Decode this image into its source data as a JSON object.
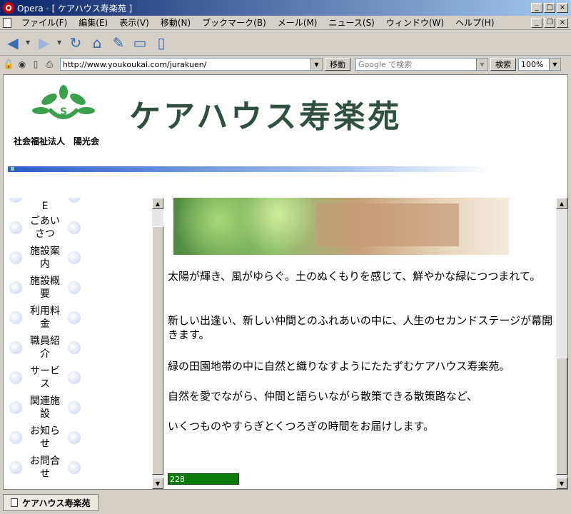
{
  "window": {
    "app_icon": "O",
    "title": "Opera - [ ケアハウス寿楽苑 ]"
  },
  "menu": {
    "items": [
      "ファイル(F)",
      "編集(E)",
      "表示(V)",
      "移動(N)",
      "ブックマーク(B)",
      "メール(M)",
      "ニュース(S)",
      "ウィンドウ(W)",
      "ヘルプ(H)"
    ]
  },
  "toolbar": {
    "icons": [
      "back-icon",
      "forward-icon",
      "reload-icon",
      "home-icon",
      "hotlist-icon",
      "print-icon",
      "new-page-icon"
    ]
  },
  "address": {
    "url": "http://www.youkoukai.com/jurakuen/",
    "go_label": "移動",
    "search_placeholder": "Google で検索",
    "search_label": "検索",
    "zoom": "100%"
  },
  "header": {
    "org_name": "社会福祉法人　陽光会",
    "site_title": "ケアハウス寿楽苑"
  },
  "nav": {
    "items": [
      {
        "label": "E"
      },
      {
        "label": "ごあいさつ"
      },
      {
        "label": "施設案内"
      },
      {
        "label": "施設概要"
      },
      {
        "label": "利用料金"
      },
      {
        "label": "職員紹介"
      },
      {
        "label": "サービス"
      },
      {
        "label": "関連施設"
      },
      {
        "label": "お知らせ"
      },
      {
        "label": "お問合せ"
      }
    ]
  },
  "main": {
    "paragraphs": [
      "太陽が輝き、風がゆらぐ。土のぬくもりを感じて、鮮やかな緑につつまれて。",
      "新しい出逢い、新しい仲間とのふれあいの中に、人生のセカンドステージが幕開きます。",
      "緑の田園地帯の中に自然と織りなすようにたたずむケアハウス寿楽苑。",
      "自然を愛でながら、仲間と語らいながら散策できる散策路など、",
      "いくつものやすらぎとくつろぎの時間をお届けします。"
    ],
    "counter": "228"
  },
  "statusbar": {
    "tab_label": "ケアハウス寿楽苑"
  },
  "colors": {
    "title_bar": "#0a246a",
    "site_title": "#2f4f3f",
    "counter": "#0a7a0a"
  }
}
